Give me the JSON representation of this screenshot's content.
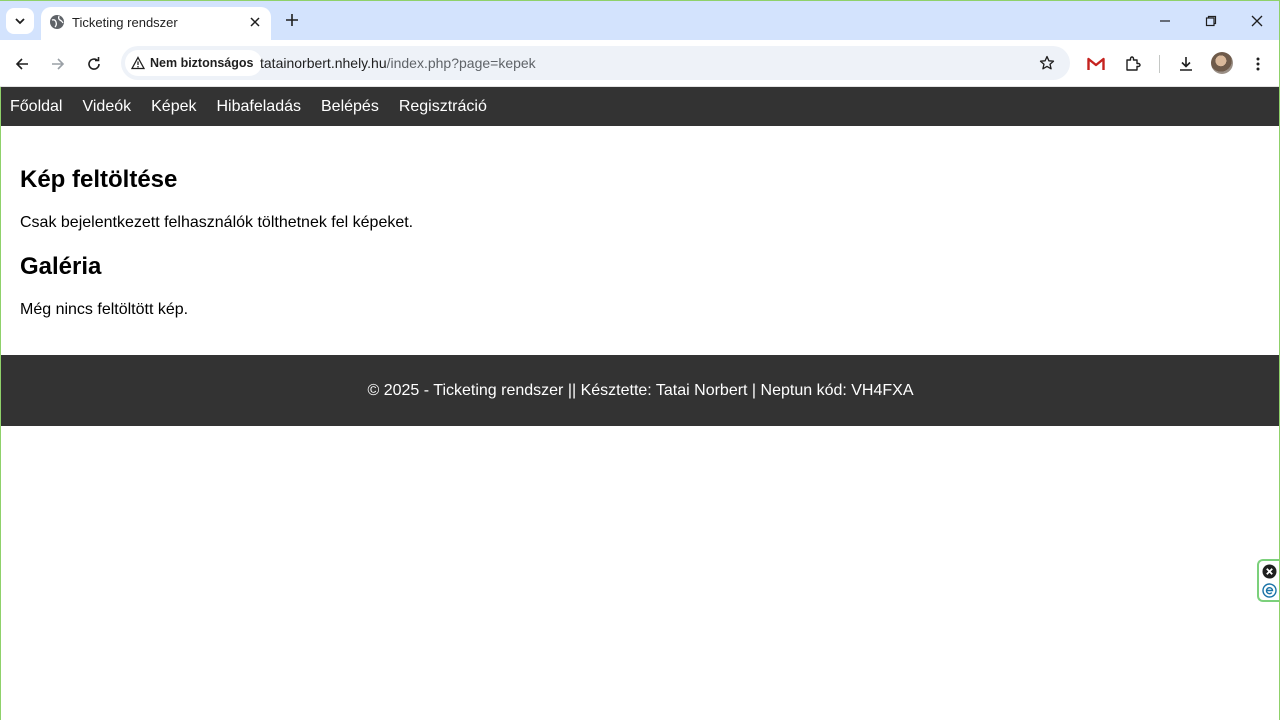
{
  "browser": {
    "tab_title": "Ticketing rendszer",
    "security_label": "Nem biztonságos",
    "url_host": "tatainorbert.nhely.hu",
    "url_path": "/index.php?page=kepek"
  },
  "nav": {
    "items": [
      {
        "label": "Főoldal"
      },
      {
        "label": "Videók"
      },
      {
        "label": "Képek"
      },
      {
        "label": "Hibafeladás"
      },
      {
        "label": "Belépés"
      },
      {
        "label": "Regisztráció"
      }
    ]
  },
  "main": {
    "upload_heading": "Kép feltöltése",
    "upload_notice": "Csak bejelentkezett felhasználók tölthetnek fel képeket.",
    "gallery_heading": "Galéria",
    "gallery_empty": "Még nincs feltöltött kép."
  },
  "footer": {
    "text": "© 2025 - Ticketing rendszer || Késztette: Tatai Norbert | Neptun kód: VH4FXA"
  },
  "colors": {
    "tabstrip": "#d3e3fd",
    "nav_bg": "#333333",
    "footer_bg": "#333333",
    "accent_green": "#8fd16a",
    "gmail_red": "#c5221f"
  },
  "icons": [
    "tab-search-icon",
    "globe-icon",
    "close-icon",
    "plus-icon",
    "minimize-icon",
    "restore-icon",
    "back-icon",
    "forward-icon",
    "reload-icon",
    "warning-icon",
    "star-icon",
    "gmail-icon",
    "extensions-icon",
    "download-icon",
    "menu-icon"
  ]
}
